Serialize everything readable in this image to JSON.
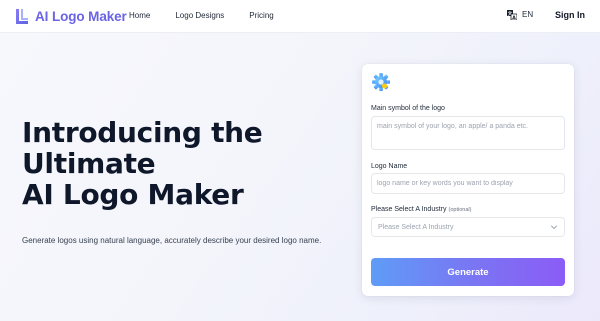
{
  "header": {
    "brand": "AI Logo Maker",
    "nav": [
      {
        "label": "Home"
      },
      {
        "label": "Logo Designs"
      },
      {
        "label": "Pricing"
      }
    ],
    "language": "EN",
    "signin": "Sign In"
  },
  "hero": {
    "title_lines": [
      "Introducing the",
      "Ultimate",
      "AI Logo Maker"
    ],
    "subtitle": "Generate logos using natural language, accurately describe your desired logo name."
  },
  "form": {
    "symbol": {
      "label": "Main symbol of the logo",
      "placeholder": "main symbol of your logo, an apple/ a panda etc.",
      "value": ""
    },
    "name": {
      "label": "Logo Name",
      "placeholder": "logo name or key words you want to display",
      "value": ""
    },
    "industry": {
      "label": "Please Select A Industry",
      "optional": "(optional)",
      "placeholder": "Please Select A Industry"
    },
    "submit": "Generate"
  },
  "colors": {
    "brand": "#6b63e6",
    "button_start": "#5f9cf7",
    "button_end": "#8b5cf6"
  },
  "icons": {
    "brand": "logo-mark-icon",
    "language": "translate-icon",
    "card": "gear-icon",
    "select": "chevron-down-icon"
  }
}
